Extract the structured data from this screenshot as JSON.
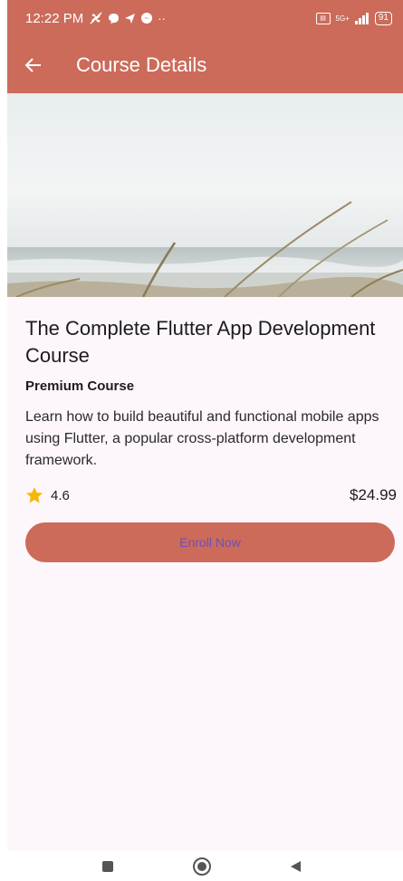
{
  "status_bar": {
    "time": "12:22 PM",
    "more_indicator": "··",
    "network_label": "5G+",
    "battery": "91"
  },
  "app_bar": {
    "title": "Course Details"
  },
  "course": {
    "title": "The Complete Flutter App Development Course",
    "badge": "Premium Course",
    "description": "Learn how to build beautiful and functional mobile apps using Flutter, a popular cross-platform development framework.",
    "rating": "4.6",
    "price": "$24.99",
    "enroll_label": "Enroll Now"
  },
  "colors": {
    "accent": "#cc6b5a",
    "background": "#fdf7fb",
    "star": "#f5b800",
    "button_text": "#6e4fb8"
  },
  "icons": {
    "back": "arrow-left-icon",
    "star": "star-icon",
    "nav_recents": "square-icon",
    "nav_home": "circle-icon",
    "nav_back": "triangle-back-icon"
  }
}
